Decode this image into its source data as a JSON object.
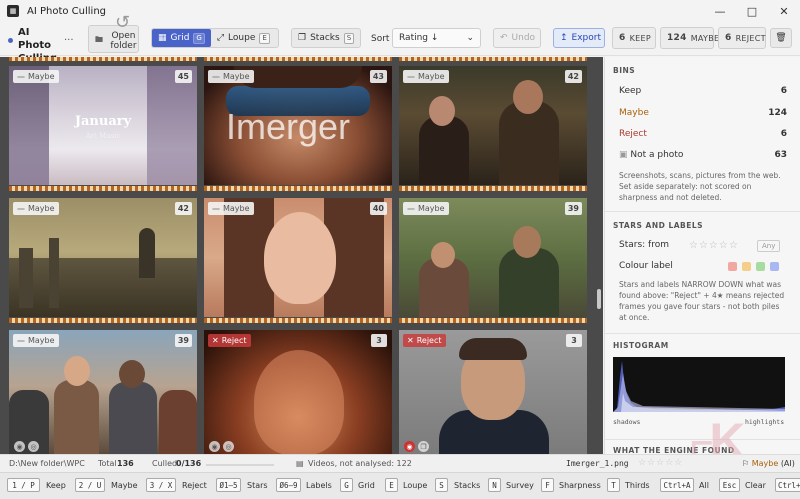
{
  "window": {
    "title": "AI Photo Culling",
    "logo": "app-logo-icon"
  },
  "toolbar": {
    "project_name": "AI Photo Culling",
    "project_more": "...",
    "open_folder": "Open folder",
    "grid_label": "Grid",
    "grid_key": "G",
    "loupe_label": "Loupe",
    "loupe_key": "E",
    "stacks_label": "Stacks",
    "stacks_key": "S",
    "sort_label": "Sort",
    "sort_value": "Rating ↓",
    "undo_label": "Undo",
    "export_label": "Export",
    "bins": {
      "keep_count": "6",
      "keep_label": "KEEP",
      "maybe_count": "124",
      "maybe_label": "MAYBE",
      "reject_count": "6",
      "reject_label": "REJECT"
    }
  },
  "grid": {
    "tiles": [
      {
        "bin": "Maybe",
        "score": "45",
        "title": "January",
        "subtitle": "Art Music"
      },
      {
        "bin": "Maybe",
        "score": "43",
        "overlay": "Imerger"
      },
      {
        "bin": "Maybe",
        "score": "42"
      },
      {
        "bin": "Maybe",
        "score": "42"
      },
      {
        "bin": "Maybe",
        "score": "40"
      },
      {
        "bin": "Maybe",
        "score": "39"
      },
      {
        "bin": "Maybe",
        "score": "39"
      },
      {
        "bin": "Reject",
        "score": "3"
      },
      {
        "bin": "Reject",
        "score": "3"
      }
    ]
  },
  "panel": {
    "bins_heading": "BINS",
    "bins": [
      {
        "label": "Keep",
        "value": "6"
      },
      {
        "label": "Maybe",
        "value": "124"
      },
      {
        "label": "Reject",
        "value": "6"
      },
      {
        "label": "Not a photo",
        "value": "63"
      }
    ],
    "bins_note": "Screenshots, scans, pictures from the web. Set aside separately: not scored on sharpness and not deleted.",
    "stars_heading": "STARS AND LABELS",
    "stars_from": "Stars: from",
    "stars_any": "Any",
    "colour_label": "Colour label",
    "label_colors": [
      "#f0a8a0",
      "#f3cf8a",
      "#a6dca0",
      "#a9b8f2"
    ],
    "stars_note": "Stars and labels NARROW DOWN what was found above: \"Reject\" + 4★ means rejected frames you gave four stars - not both piles at once.",
    "histogram_heading": "HISTOGRAM",
    "histogram_left": "shadows",
    "histogram_right": "highlights",
    "engine_heading": "WHAT THE ENGINE FOUND"
  },
  "status": {
    "path": "D:\\New folder\\WPC",
    "total_label": "Total",
    "total_value": "136",
    "culled_label": "Culled",
    "culled_value": "0/136",
    "culled_fraction": 0,
    "videos": "Videos, not analysed: 122",
    "file": "Imerger_1.png",
    "ai_label": "Maybe",
    "ai_suffix": "(AI)"
  },
  "shortcuts": [
    {
      "key": "1 / P",
      "label": "Keep"
    },
    {
      "key": "2 / U",
      "label": "Maybe"
    },
    {
      "key": "3 / X",
      "label": "Reject"
    },
    {
      "key": "Ø1–5",
      "label": "Stars"
    },
    {
      "key": "Ø6–9",
      "label": "Labels"
    },
    {
      "key": "G",
      "label": "Grid"
    },
    {
      "key": "E",
      "label": "Loupe"
    },
    {
      "key": "S",
      "label": "Stacks"
    },
    {
      "key": "N",
      "label": "Survey"
    },
    {
      "key": "F",
      "label": "Sharpness"
    },
    {
      "key": "T",
      "label": "Thirds"
    },
    {
      "key": "Ctrl+A",
      "label": "All"
    },
    {
      "key": "Esc",
      "label": "Clear"
    },
    {
      "key": "Ctrl+",
      "label": ""
    }
  ]
}
